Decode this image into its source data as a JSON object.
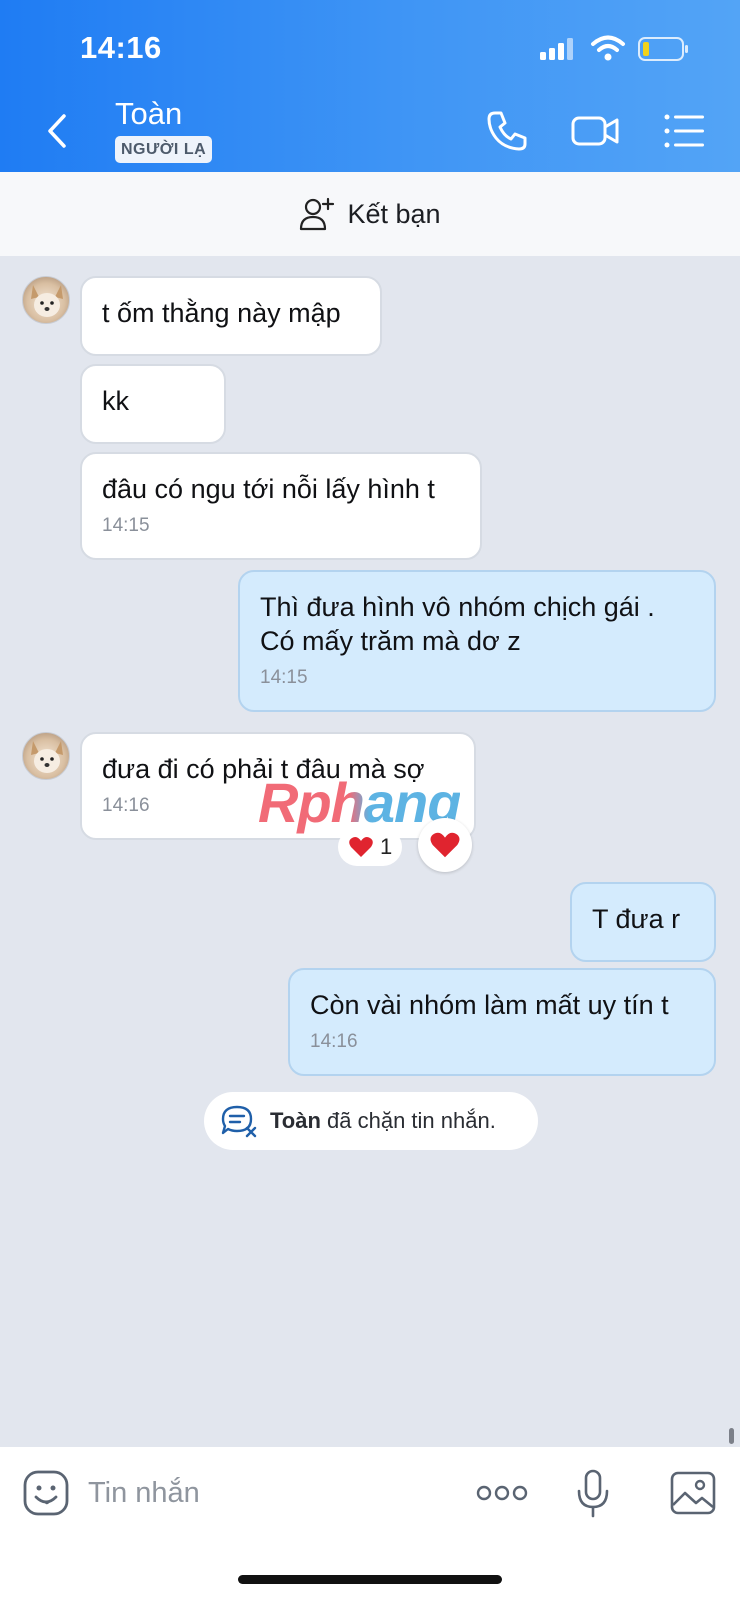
{
  "status_bar": {
    "time": "14:16"
  },
  "header": {
    "contact_name": "Toàn",
    "badge": "NGƯỜI LẠ",
    "accent_color": "#2f86f4"
  },
  "add_friend": {
    "label": "Kết bạn"
  },
  "messages": [
    {
      "sender": "other",
      "text": "t ốm thằng này mập",
      "time": ""
    },
    {
      "sender": "other",
      "text": "kk",
      "time": ""
    },
    {
      "sender": "other",
      "text": "đâu có ngu tới nỗi lấy hình t",
      "time": "14:15"
    },
    {
      "sender": "me",
      "line1": "Thì  đưa hình vô nhóm chịch gái .",
      "line2": "Có mấy trăm mà dơ z",
      "time": "14:15"
    },
    {
      "sender": "other",
      "text": "đưa đi có phải t đâu mà sợ",
      "time": "14:16",
      "reaction_count": "1"
    },
    {
      "sender": "me",
      "text": "T đưa r",
      "time": ""
    },
    {
      "sender": "me",
      "text": "Còn vài nhóm làm mất uy tín t",
      "time": "14:16"
    }
  ],
  "watermark": "Rphang",
  "blocked_note": {
    "name": "Toàn",
    "text": " đã chặn tin nhắn."
  },
  "composer": {
    "placeholder": "Tin nhắn"
  },
  "icons": [
    "back-icon",
    "phone-icon",
    "video-call-icon",
    "menu-list-icon",
    "add-friend-icon",
    "heart-icon",
    "blocked-message-icon",
    "emoji-icon",
    "more-icon",
    "mic-icon",
    "photo-icon"
  ]
}
